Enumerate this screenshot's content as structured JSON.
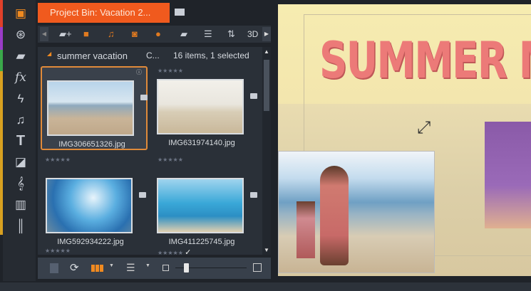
{
  "sidebar": {
    "colors": [
      "#e0402a",
      "#9a3cc8",
      "#3aa84a",
      "#d8a020"
    ],
    "items": [
      "bin-icon",
      "film-reel-icon",
      "folder-icon",
      "fx-icon",
      "lightning-icon",
      "music-icon",
      "text-icon",
      "transition-icon",
      "clef-icon",
      "piano-icon",
      "waveform-icon"
    ]
  },
  "panel": {
    "tab_title": "Project Bin: Vacation 2...",
    "toolbar_3d": "3D",
    "breadcrumb": "summer vacation",
    "breadcrumb_col": "C...",
    "count": "16 items, 1 selected",
    "items": [
      {
        "name": "IMG306651326.jpg",
        "selected": true,
        "rating": 0
      },
      {
        "name": "IMG631974140.jpg",
        "selected": false,
        "rating": 0
      },
      {
        "name": "IMG592934222.jpg",
        "selected": false,
        "rating": 0
      },
      {
        "name": "IMG411225745.jpg",
        "selected": false,
        "rating": 0,
        "checked": true
      }
    ]
  },
  "preview": {
    "title_text": "SUMMER M"
  },
  "accent": "#f05a1e"
}
